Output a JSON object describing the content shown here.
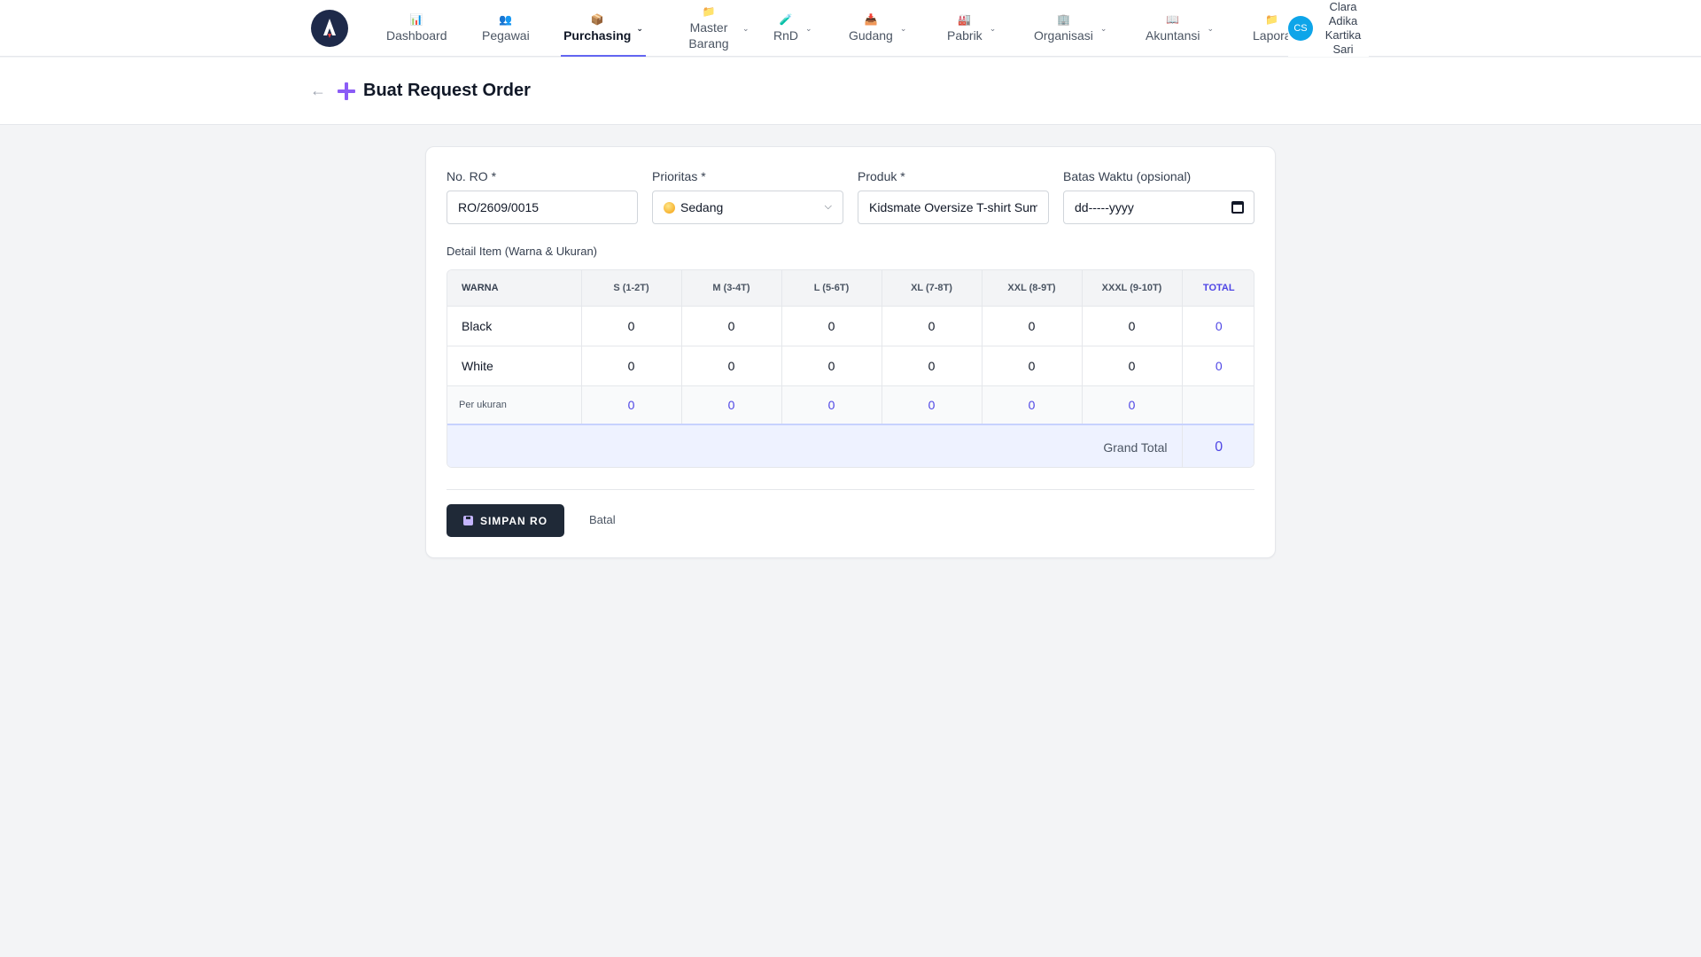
{
  "nav": {
    "items": [
      {
        "label": "Dashboard",
        "icon": "bar-chart-icon",
        "glyph": "📊"
      },
      {
        "label": "Pegawai",
        "icon": "people-icon",
        "glyph": "👥"
      },
      {
        "label": "Purchasing",
        "icon": "package-icon",
        "glyph": "📦"
      },
      {
        "label": "Master Barang",
        "icon": "folder-icon",
        "glyph": "📁"
      },
      {
        "label": "RnD",
        "icon": "test-tube-icon",
        "glyph": "🧪"
      },
      {
        "label": "Gudang",
        "icon": "inbox-icon",
        "glyph": "📥"
      },
      {
        "label": "Pabrik",
        "icon": "factory-icon",
        "glyph": "🏭"
      },
      {
        "label": "Organisasi",
        "icon": "office-building-icon",
        "glyph": "🏢"
      },
      {
        "label": "Akuntansi",
        "icon": "book-icon",
        "glyph": "📖"
      },
      {
        "label": "Lapora",
        "icon": "folder-icon",
        "glyph": "📁"
      }
    ],
    "active": "Purchasing"
  },
  "user": {
    "initials": "CS",
    "name": "Clara Adika Kartika Sari"
  },
  "page": {
    "back": "←",
    "title": "Buat Request Order"
  },
  "form": {
    "no_ro": {
      "label": "No. RO *",
      "value": "RO/2609/0015"
    },
    "prioritas": {
      "label": "Prioritas *",
      "value": "Sedang"
    },
    "produk": {
      "label": "Produk *",
      "value": "Kidsmate Oversize T-shirt Summer"
    },
    "batas_waktu": {
      "label": "Batas Waktu (opsional)",
      "placeholder": "dd-----yyyy"
    }
  },
  "detail": {
    "label": "Detail Item (Warna & Ukuran)",
    "headers": [
      "WARNA",
      "S (1-2T)",
      "M (3-4T)",
      "L (5-6T)",
      "XL (7-8T)",
      "XXL (8-9T)",
      "XXXL (9-10T)",
      "TOTAL"
    ],
    "rows": [
      {
        "color": "Black",
        "values": [
          "0",
          "0",
          "0",
          "0",
          "0",
          "0"
        ],
        "total": "0"
      },
      {
        "color": "White",
        "values": [
          "0",
          "0",
          "0",
          "0",
          "0",
          "0"
        ],
        "total": "0"
      }
    ],
    "per_size": {
      "label": "Per ukuran",
      "values": [
        "0",
        "0",
        "0",
        "0",
        "0",
        "0"
      ]
    },
    "grand_total": {
      "label": "Grand Total",
      "value": "0"
    }
  },
  "actions": {
    "save": "SIMPAN RO",
    "cancel": "Batal"
  }
}
